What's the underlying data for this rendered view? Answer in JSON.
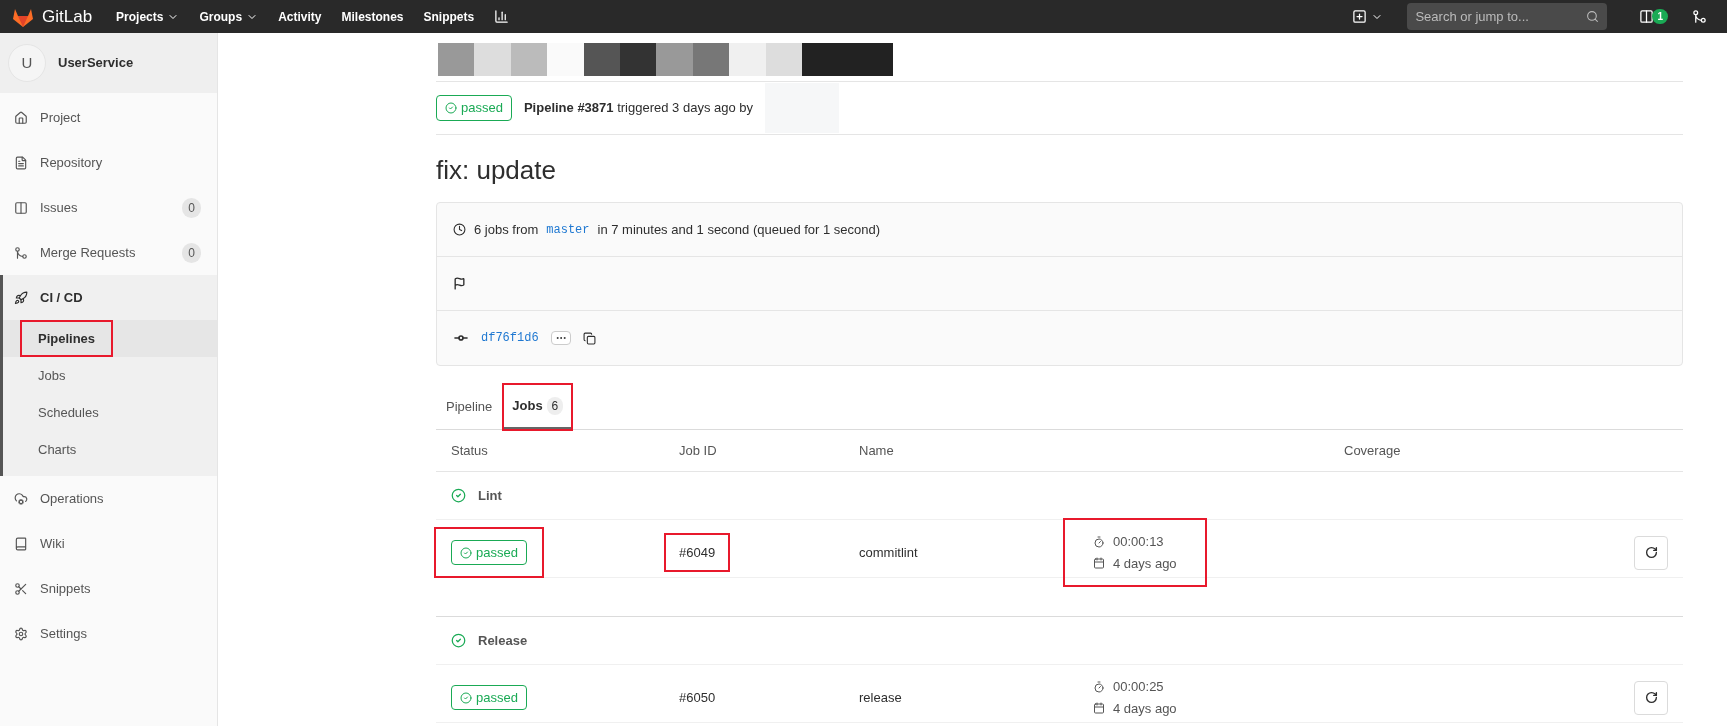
{
  "navbar": {
    "logo_text": "GitLab",
    "menu": [
      {
        "label": "Projects",
        "dropdown": true
      },
      {
        "label": "Groups",
        "dropdown": true
      },
      {
        "label": "Activity",
        "dropdown": false
      },
      {
        "label": "Milestones",
        "dropdown": false
      },
      {
        "label": "Snippets",
        "dropdown": false
      }
    ],
    "search": {
      "placeholder": "Search or jump to..."
    },
    "todo_count": "1"
  },
  "sidebar": {
    "project": {
      "avatar": "U",
      "name": "UserService"
    },
    "items": [
      {
        "label": "Project",
        "selected": false
      },
      {
        "label": "Repository",
        "selected": false
      },
      {
        "label": "Issues",
        "badge": "0",
        "selected": false
      },
      {
        "label": "Merge Requests",
        "badge": "0",
        "selected": false
      },
      {
        "label": "CI / CD",
        "selected": true,
        "expanded": true,
        "children": [
          {
            "label": "Pipelines",
            "selected": true,
            "highlighted": true
          },
          {
            "label": "Jobs",
            "selected": false,
            "highlighted": false
          },
          {
            "label": "Schedules",
            "selected": false,
            "highlighted": false
          },
          {
            "label": "Charts",
            "selected": false,
            "highlighted": false
          }
        ]
      },
      {
        "label": "Operations",
        "selected": false
      },
      {
        "label": "Wiki",
        "selected": false
      },
      {
        "label": "Snippets",
        "selected": false
      },
      {
        "label": "Settings",
        "selected": false
      }
    ]
  },
  "pipeline": {
    "status": "passed",
    "summary": "**Pipeline #3871** triggered 3 days ago by",
    "title": "fix: update",
    "jobs_text": "6 jobs from",
    "branch": "master",
    "duration_text": "in 7 minutes and 1 second (queued for 1 second)",
    "commit": "df76f1d6"
  },
  "tabs": [
    {
      "label": "Pipeline",
      "selected": false,
      "highlighted": false
    },
    {
      "label": "Jobs",
      "count": "6",
      "selected": true,
      "highlighted": true
    }
  ],
  "table": {
    "columns": [
      "Status",
      "Job ID",
      "Name",
      "Coverage"
    ],
    "stages": [
      {
        "name": "Lint",
        "jobs": [
          {
            "status": "passed",
            "id": "#6049",
            "name": "commitlint",
            "duration": "00:00:13",
            "finished": "4 days ago",
            "status_highlighted": true,
            "id_highlighted": true,
            "time_highlighted": true
          }
        ]
      },
      {
        "name": "Release",
        "jobs": [
          {
            "status": "passed",
            "id": "#6050",
            "name": "release",
            "duration": "00:00:25",
            "finished": "4 days ago",
            "status_highlighted": false,
            "id_highlighted": false,
            "time_highlighted": false
          }
        ]
      }
    ]
  }
}
